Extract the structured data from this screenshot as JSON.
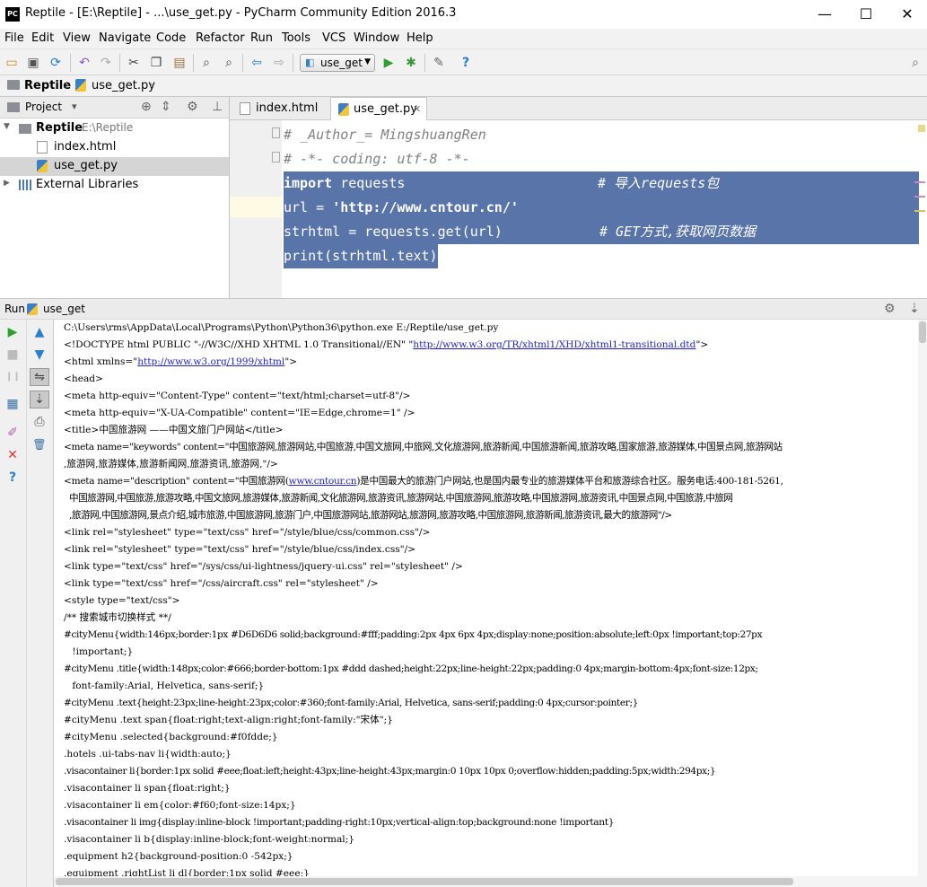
{
  "window": {
    "title": "Reptile - [E:\\Reptile] - ...\\use_get.py - PyCharm Community Edition 2016.3",
    "logo": "PC",
    "minimize": "—",
    "maximize": "☐",
    "close": "✕"
  },
  "menu": [
    "File",
    "Edit",
    "View",
    "Navigate",
    "Code",
    "Refactor",
    "Run",
    "Tools",
    "VCS",
    "Window",
    "Help"
  ],
  "toolbar": {
    "run_config": "use_get",
    "chevron": "▼"
  },
  "breadcrumb": {
    "project": "Reptile",
    "file": "use_get.py",
    "sep": "›"
  },
  "project_panel": {
    "title": "Project",
    "caret": "▾",
    "tree": [
      {
        "label": "Reptile",
        "path": "E:\\Reptile",
        "expander": "▼"
      },
      {
        "label": "index.html"
      },
      {
        "label": "use_get.py"
      },
      {
        "label": "External Libraries",
        "expander": "▶"
      }
    ]
  },
  "editor": {
    "tabs": [
      {
        "label": "index.html"
      },
      {
        "label": "use_get.py",
        "close": "✕"
      }
    ],
    "lines": [
      {
        "text": "# _Author_= MingshuangRen"
      },
      {
        "text": "# -*- coding: utf-8 -*-"
      },
      {
        "kw": "import",
        "rest": " requests",
        "comment": "# 导入requests包"
      },
      {
        "pre": "url = ",
        "str": "'http://www.cntour.cn/'"
      },
      {
        "pre": "strhtml = requests.get(url)",
        "comment": "# GET方式,获取网页数据"
      },
      {
        "pre": "print(strhtml.text)"
      }
    ]
  },
  "run": {
    "label": "Run",
    "config": "use_get",
    "console": [
      "C:\\Users\\rms\\AppData\\Local\\Programs\\Python\\Python36\\python.exe E:/Reptile/use_get.py",
      "<!DOCTYPE html PUBLIC \"-//W3C//XHD XHTML 1.0 Transitional//EN\" \"",
      "http://www.w3.org/TR/xhtml1/XHD/xhtml1-transitional.dtd",
      "\">",
      "<html xmlns=\"",
      "http://www.w3.org/1999/xhtml",
      "\">",
      "<head>",
      "<meta http-equiv=\"Content-Type\" content=\"text/html;charset=utf-8\"/>",
      "<meta http-equiv=\"X-UA-Compatible\" content=\"IE=Edge,chrome=1\" />",
      "<title>中国旅游网 ——中国文旅门户网站</title>",
      "<meta name=\"keywords\" content=\"中国旅游网,旅游网站,中国旅游,中国文旅网,中旅网,文化旅游网,旅游新闻,中国旅游新闻,旅游攻略,国家旅游,旅游媒体,中国景点网,旅游网站",
      ",旅游网,旅游媒体,旅游新闻网,旅游资讯,旅游网,\"/>",
      "<meta name=\"description\" content=\"中国旅游网(",
      "www.cntour.cn",
      ")是中国最大的旅游门户网站,也是国内最专业的旅游媒体平台和旅游综合社区。服务电话:400-181-5261,",
      "中国旅游网,中国旅游,旅游攻略,中国文旅网,旅游媒体,旅游新闻,文化旅游网,旅游资讯,旅游网站,中国旅游网,旅游攻略,中国旅游网,旅游资讯,中国景点网,中国旅游,中旅网",
      ",旅游网,中国旅游网,景点介绍,城市旅游,中国旅游网,旅游门户,中国旅游网站,旅游网站,旅游网,旅游攻略,中国旅游网,旅游新闻,旅游资讯,最大的旅游网\"/>",
      "<link rel=\"stylesheet\" type=\"text/css\" href=\"/style/blue/css/common.css\"/>",
      "<link rel=\"stylesheet\" type=\"text/css\" href=\"/style/blue/css/index.css\"/>",
      "<link type=\"text/css\" href=\"/sys/css/ui-lightness/jquery-ui.css\" rel=\"stylesheet\" />",
      "<link type=\"text/css\" href=\"/css/aircraft.css\" rel=\"stylesheet\" />",
      "<style type=\"text/css\">",
      "/** 搜索城市切换样式 **/",
      "#cityMenu{width:146px;border:1px #D6D6D6 solid;background:#fff;padding:2px 4px 6px 4px;display:none;position:absolute;left:0px !important;top:27px",
      " !important;}",
      "#cityMenu .title{width:148px;color:#666;border-bottom:1px #ddd dashed;height:22px;line-height:22px;padding:0 4px;margin-bottom:4px;font-size:12px;",
      " font-family:Arial, Helvetica, sans-serif;}",
      "#cityMenu .text{height:23px;line-height:23px;color:#360;font-family:Arial, Helvetica, sans-serif;padding:0 4px;cursor:pointer;}",
      "#cityMenu .text span{float:right;text-align:right;font-family:\"宋体\";}",
      "#cityMenu .selected{background:#f0fdde;}",
      ".hotels .ui-tabs-nav li{width:auto;}",
      ".visacontainer li{border:1px solid #eee;float:left;height:43px;line-height:43px;margin:0 10px 10px 0;overflow:hidden;padding:5px;width:294px;}",
      ".visacontainer li span{float:right;}",
      ".visacontainer li em{color:#f60;font-size:14px;}",
      ".visacontainer li img{display:inline-block !important;padding-right:10px;vertical-align:top;background:none !important}",
      ".visacontainer li b{display:inline-block;font-weight:normal;}",
      ".equipment h2{background-position:0 -542px;}",
      ".equipment .rightList li dl{border:1px solid #eee;}"
    ]
  },
  "icons": {
    "open": "▭",
    "save": "▣",
    "sync": "⟳",
    "undo": "↶",
    "redo": "↷",
    "cut": "✂",
    "copy": "❐",
    "paste": "▤",
    "find": "⌕",
    "replace": "⌕",
    "back": "⇦",
    "forward": "⇨",
    "run": "▶",
    "debug": "✱",
    "settings": "✎",
    "help": "?",
    "search": "⌕",
    "gear": "⚙",
    "collapse": "⇕",
    "pin": "⊥",
    "locate": "⊕",
    "rerun": "▶",
    "stop": "■",
    "pause": "❙❙",
    "up": "▲",
    "down": "▼",
    "wrap": "⇋",
    "scroll": "⇣",
    "print": "⎙",
    "trash": "🗑",
    "pinrun": "✐",
    "closex": "✕",
    "helpq": "?",
    "layout": "▦",
    "bar": "▥",
    "minus": "⇣"
  }
}
